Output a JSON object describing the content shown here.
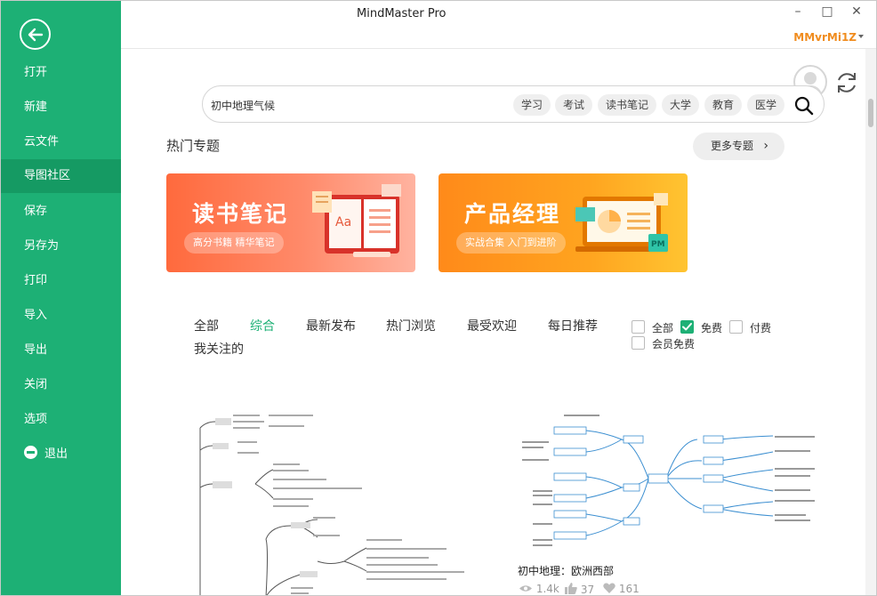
{
  "window": {
    "title": "MindMaster Pro",
    "username": "MMvrMi1Z",
    "minimize": "–",
    "maximize": "□",
    "close": "✕"
  },
  "sidebar": {
    "items": [
      {
        "label": "打开"
      },
      {
        "label": "新建"
      },
      {
        "label": "云文件"
      },
      {
        "label": "导图社区"
      },
      {
        "label": "保存"
      },
      {
        "label": "另存为"
      },
      {
        "label": "打印"
      },
      {
        "label": "导入"
      },
      {
        "label": "导出"
      },
      {
        "label": "关闭"
      },
      {
        "label": "选项"
      },
      {
        "label": "退出"
      }
    ],
    "active_index": 3
  },
  "search": {
    "value": "初中地理气候",
    "tags": [
      "学习",
      "考试",
      "读书笔记",
      "大学",
      "教育",
      "医学"
    ]
  },
  "hot": {
    "title": "热门专题",
    "more": "更多专题",
    "banners": [
      {
        "title": "读书笔记",
        "subtitle": "高分书籍 精华笔记"
      },
      {
        "title": "产品经理",
        "subtitle": "实战合集 入门到进阶",
        "badge": "PM"
      }
    ]
  },
  "filters": {
    "tabs": [
      "全部",
      "综合",
      "最新发布",
      "热门浏览",
      "最受欢迎",
      "每日推荐",
      "我关注的"
    ],
    "active_tab": "综合",
    "price": [
      {
        "label": "全部",
        "checked": false
      },
      {
        "label": "免费",
        "checked": true
      },
      {
        "label": "付费",
        "checked": false
      },
      {
        "label": "会员免费",
        "checked": false
      }
    ]
  },
  "cards": [
    {
      "title": "",
      "views": "",
      "likes": "",
      "favorites": ""
    },
    {
      "title": "初中地理：欧洲西部",
      "views": "1.4k",
      "likes": "37",
      "favorites": "161"
    }
  ],
  "colors": {
    "sidebar": "#1db075",
    "sidebar_active": "#159a63",
    "accent": "#1db075",
    "username": "#f08c1e"
  }
}
